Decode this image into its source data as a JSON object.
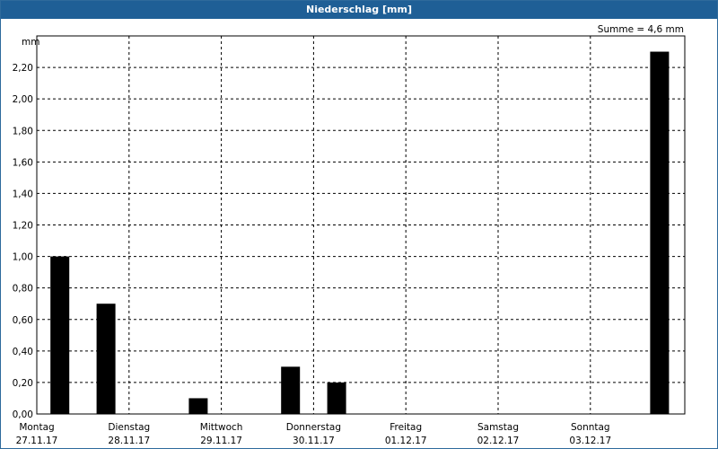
{
  "window": {
    "title": "Niederschlag [mm]"
  },
  "chart_data": {
    "type": "bar",
    "title": "Niederschlag [mm]",
    "ylabel": "mm",
    "summary": "Summe = 4,6 mm",
    "ylim": [
      0,
      2.4
    ],
    "yticks": [
      "0,00",
      "0,20",
      "0,40",
      "0,60",
      "0,80",
      "1,00",
      "1,20",
      "1,40",
      "1,60",
      "1,80",
      "2,00",
      "2,20"
    ],
    "days": [
      {
        "name": "Montag",
        "date": "27.11.17"
      },
      {
        "name": "Dienstag",
        "date": "28.11.17"
      },
      {
        "name": "Mittwoch",
        "date": "29.11.17"
      },
      {
        "name": "Donnerstag",
        "date": "30.11.17"
      },
      {
        "name": "Freitag",
        "date": "01.12.17"
      },
      {
        "name": "Samstag",
        "date": "02.12.17"
      },
      {
        "name": "Sonntag",
        "date": "03.12.17"
      }
    ],
    "series": [
      {
        "x_hours": [
          0,
          12,
          24,
          36,
          48,
          60,
          72,
          84,
          96,
          108,
          120,
          132,
          144,
          156
        ],
        "values": [
          1.0,
          0.7,
          0,
          0.1,
          0,
          0.3,
          0.2,
          0,
          0,
          0,
          0,
          0,
          0,
          2.3
        ]
      }
    ],
    "grid": true,
    "bar_color": "#000000"
  }
}
